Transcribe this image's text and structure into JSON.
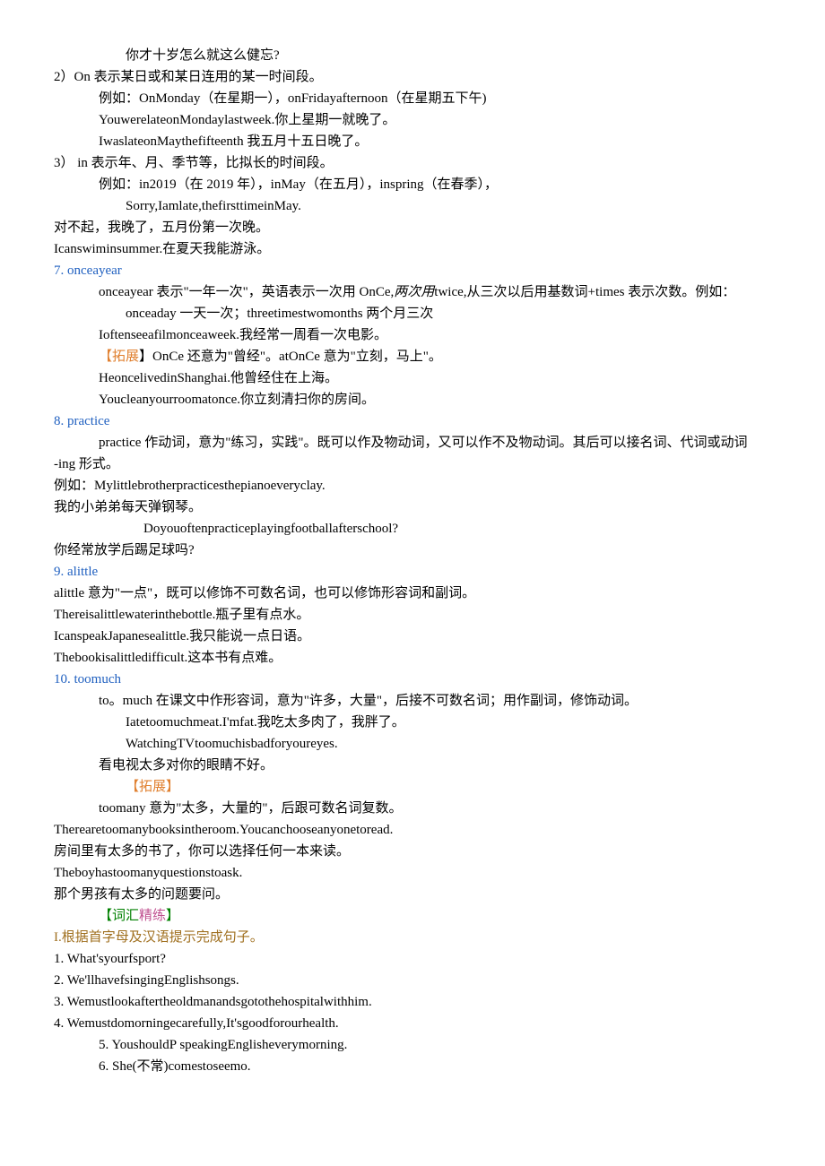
{
  "lines": [
    {
      "cls": "indent2",
      "segs": [
        {
          "t": "你才十岁怎么就这么健忘?"
        }
      ]
    },
    {
      "cls": "",
      "segs": [
        {
          "t": "2）On 表示某日或和某日连用的某一时间段。"
        }
      ]
    },
    {
      "cls": "indent1",
      "segs": [
        {
          "t": "例如：OnMonday（在星期一），onFridayafternoon（在星期五下午)"
        }
      ]
    },
    {
      "cls": "indent1",
      "segs": [
        {
          "t": "YouwerelateonMondaylastweek.你上星期一就晚了。"
        }
      ]
    },
    {
      "cls": "indent1",
      "segs": [
        {
          "t": "IwaslateonMaythefifteenth 我五月十五日晚了。"
        }
      ]
    },
    {
      "cls": "",
      "segs": [
        {
          "t": "3） in 表示年、月、季节等，比拟长的时间段。"
        }
      ]
    },
    {
      "cls": "indent1",
      "segs": [
        {
          "t": "例如：in2019（在 2019 年），inMay（在五月），inspring（在春季），"
        }
      ]
    },
    {
      "cls": "indent2",
      "segs": [
        {
          "t": "Sorry,Iamlate,thefirsttimeinMay."
        }
      ]
    },
    {
      "cls": "",
      "segs": [
        {
          "t": "对不起，我晚了，五月份第一次晚。"
        }
      ]
    },
    {
      "cls": "",
      "segs": [
        {
          "t": "Icanswiminsummer.在夏天我能游泳。"
        }
      ]
    },
    {
      "cls": "",
      "segs": [
        {
          "t": "7.  onceayear",
          "c": "blue"
        }
      ]
    },
    {
      "cls": "indent1",
      "segs": [
        {
          "t": "onceayear 表示\"一年一次\"，英语表示一次用 OnCe,"
        },
        {
          "t": "两次用",
          "i": true
        },
        {
          "t": "twice,从三次以后用基数词+times 表示次数。例如："
        }
      ]
    },
    {
      "cls": "indent2",
      "segs": [
        {
          "t": "onceaday 一天一次；threetimestwomonths 两个月三次"
        }
      ]
    },
    {
      "cls": "indent1",
      "segs": [
        {
          "t": "Ioftenseeafilmonceaweek.我经常一周看一次电影。"
        }
      ]
    },
    {
      "cls": "indent1",
      "segs": [
        {
          "t": "【",
          "c": "orange"
        },
        {
          "t": "拓展",
          "c": "orange"
        },
        {
          "t": "】"
        },
        {
          "t": "OnCe 还意为\"曾经\"。atOnCe 意为\"立刻，马上\"。"
        }
      ]
    },
    {
      "cls": "indent1",
      "segs": [
        {
          "t": "HeoncelivedinShanghai.他曾经住在上海。"
        }
      ]
    },
    {
      "cls": "indent1",
      "segs": [
        {
          "t": "Youcleanyourroomatonce.你立刻清扫你的房间。"
        }
      ]
    },
    {
      "cls": "",
      "segs": [
        {
          "t": "8.  practice",
          "c": "blue"
        }
      ]
    },
    {
      "cls": "indent1",
      "segs": [
        {
          "t": "practice 作动词，意为\"练习，实践\"。既可以作及物动词，又可以作不及物动词。其后可以接名词、代词或动词"
        }
      ]
    },
    {
      "cls": "",
      "segs": [
        {
          "t": "-ing 形式。"
        }
      ]
    },
    {
      "cls": "",
      "segs": [
        {
          "t": "例如：Mylittlebrotherpracticesthepianoeveryclay."
        }
      ]
    },
    {
      "cls": "",
      "segs": [
        {
          "t": "我的小弟弟每天弹钢琴。"
        }
      ]
    },
    {
      "cls": "indent3",
      "segs": [
        {
          "t": "Doyouoftenpracticeplayingfootballafterschool?"
        }
      ]
    },
    {
      "cls": "",
      "segs": [
        {
          "t": "你经常放学后踢足球吗?"
        }
      ]
    },
    {
      "cls": "",
      "segs": [
        {
          "t": "9.  alittle",
          "c": "blue"
        }
      ]
    },
    {
      "cls": "",
      "segs": [
        {
          "t": "alittle 意为\"一点\"，既可以修饰不可数名词，也可以修饰形容词和副词。"
        }
      ]
    },
    {
      "cls": "",
      "segs": [
        {
          "t": "Thereisalittlewaterinthebottle.瓶子里有点水。"
        }
      ]
    },
    {
      "cls": "",
      "segs": [
        {
          "t": "IcanspeakJapanesealittle.我只能说一点日语。"
        }
      ]
    },
    {
      "cls": "",
      "segs": [
        {
          "t": "Thebookisalittledifficult.这本书有点难。"
        }
      ]
    },
    {
      "cls": "",
      "segs": [
        {
          "t": "10.  toomuch",
          "c": "blue"
        }
      ]
    },
    {
      "cls": "indent1",
      "segs": [
        {
          "t": "to。much 在课文中作形容词，意为\"许多，大量\"，后接不可数名词；用作副词，修饰动词。"
        }
      ]
    },
    {
      "cls": "indent2",
      "segs": [
        {
          "t": "Iatetoomuchmeat.I'mfat.我吃太多肉了，我胖了。"
        }
      ]
    },
    {
      "cls": "indent2",
      "segs": [
        {
          "t": "WatchingTVtoomuchisbadforyoureyes."
        }
      ]
    },
    {
      "cls": "indent1",
      "segs": [
        {
          "t": "看电视太多对你的眼睛不好。"
        }
      ]
    },
    {
      "cls": "indent2",
      "segs": [
        {
          "t": "【拓展】",
          "c": "orange"
        }
      ]
    },
    {
      "cls": "indent1",
      "segs": [
        {
          "t": "toomany 意为\"太多，大量的\"，后跟可数名词复数。"
        }
      ]
    },
    {
      "cls": "",
      "segs": [
        {
          "t": "Therearetoomanybooksintheroom.Youcanchooseanyonetoread."
        }
      ]
    },
    {
      "cls": "",
      "segs": [
        {
          "t": "房间里有太多的书了，你可以选择任何一本来读。"
        }
      ]
    },
    {
      "cls": "",
      "segs": [
        {
          "t": "Theboyhastoomanyquestionstoask."
        }
      ]
    },
    {
      "cls": "",
      "segs": [
        {
          "t": "那个男孩有太多的问题要问。"
        }
      ]
    },
    {
      "cls": "indent1",
      "segs": [
        {
          "t": "【词汇",
          "c": "green"
        },
        {
          "t": "精练",
          "c": "pink"
        },
        {
          "t": "】",
          "c": "green"
        }
      ]
    },
    {
      "cls": "",
      "segs": [
        {
          "t": "I.根据首字母及汉语提示完成句子。",
          "c": "gold"
        }
      ]
    },
    {
      "cls": "",
      "segs": [
        {
          "t": "1.  What'syourfsport?"
        }
      ]
    },
    {
      "cls": "",
      "segs": [
        {
          "t": "2.  We'llhavefsingingEnglishsongs."
        }
      ]
    },
    {
      "cls": "",
      "segs": [
        {
          "t": "3.  Wemustlookaftertheoldmanandsgotothehospitalwithhim."
        }
      ]
    },
    {
      "cls": "",
      "segs": [
        {
          "t": "4.  Wemustdomorningecarefully,It'sgoodforourhealth."
        }
      ]
    },
    {
      "cls": "indent1",
      "segs": [
        {
          "t": "5.  YoushouldP            speakingEnglisheverymorning."
        }
      ]
    },
    {
      "cls": "indent1",
      "segs": [
        {
          "t": "6.  She(不常)comestoseemo."
        }
      ]
    }
  ]
}
